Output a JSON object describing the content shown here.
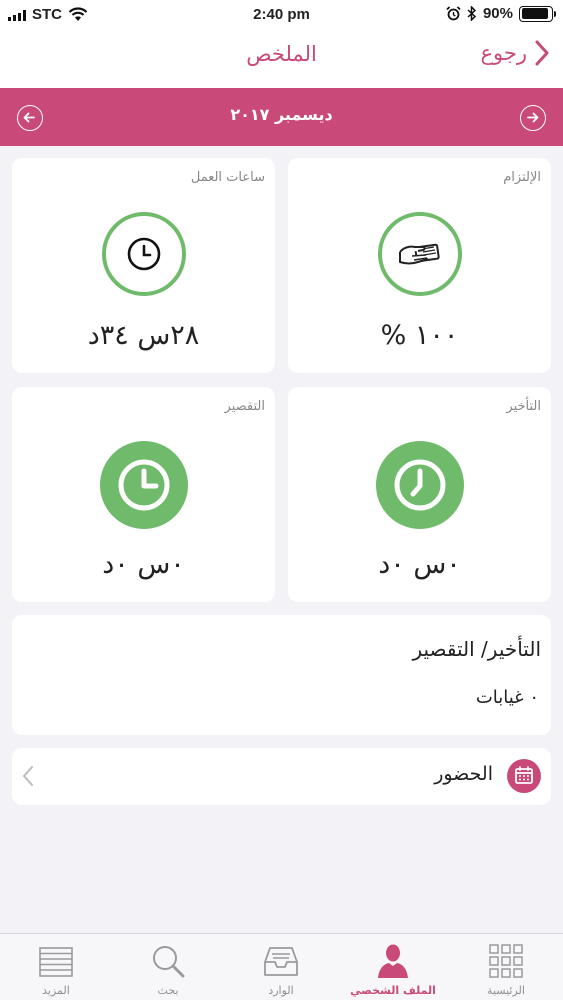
{
  "status_bar": {
    "carrier": "STC",
    "time": "2:40 pm",
    "battery_percent": "90%",
    "battery_level": 0.9
  },
  "nav": {
    "title": "الملخص",
    "back_label": "رجوع"
  },
  "month_bar": {
    "label": "ديسمبر ٢٠١٧"
  },
  "cards": {
    "commitment": {
      "title": "الإلتزام",
      "value": "١٠٠ %",
      "icon": "hand-card-icon"
    },
    "work_hours": {
      "title": "ساعات العمل",
      "value": "٢٨س ٣٤د",
      "icon": "clock-icon"
    },
    "delay": {
      "title": "التأخير",
      "value": "٠س ٠د",
      "icon": "clock-late-icon"
    },
    "shortfall": {
      "title": "التقصير",
      "value": "٠س ٠د",
      "icon": "clock-short-icon"
    }
  },
  "summary": {
    "title": "التأخير/ التقصير",
    "absences": "٠ غيابات"
  },
  "attendance": {
    "label": "الحضور",
    "icon": "calendar-icon"
  },
  "tabs": [
    {
      "label": "الرئيسية",
      "icon": "grid-icon",
      "active": false
    },
    {
      "label": "الملف الشخصي",
      "icon": "profile-icon",
      "active": true
    },
    {
      "label": "الوارد",
      "icon": "inbox-icon",
      "active": false
    },
    {
      "label": "بحث",
      "icon": "search-icon",
      "active": false
    },
    {
      "label": "المزيد",
      "icon": "more-lines-icon",
      "active": false
    }
  ],
  "colors": {
    "brand": "#c94a78",
    "accent_green": "#6fba6b",
    "background": "#f3f2f6"
  }
}
